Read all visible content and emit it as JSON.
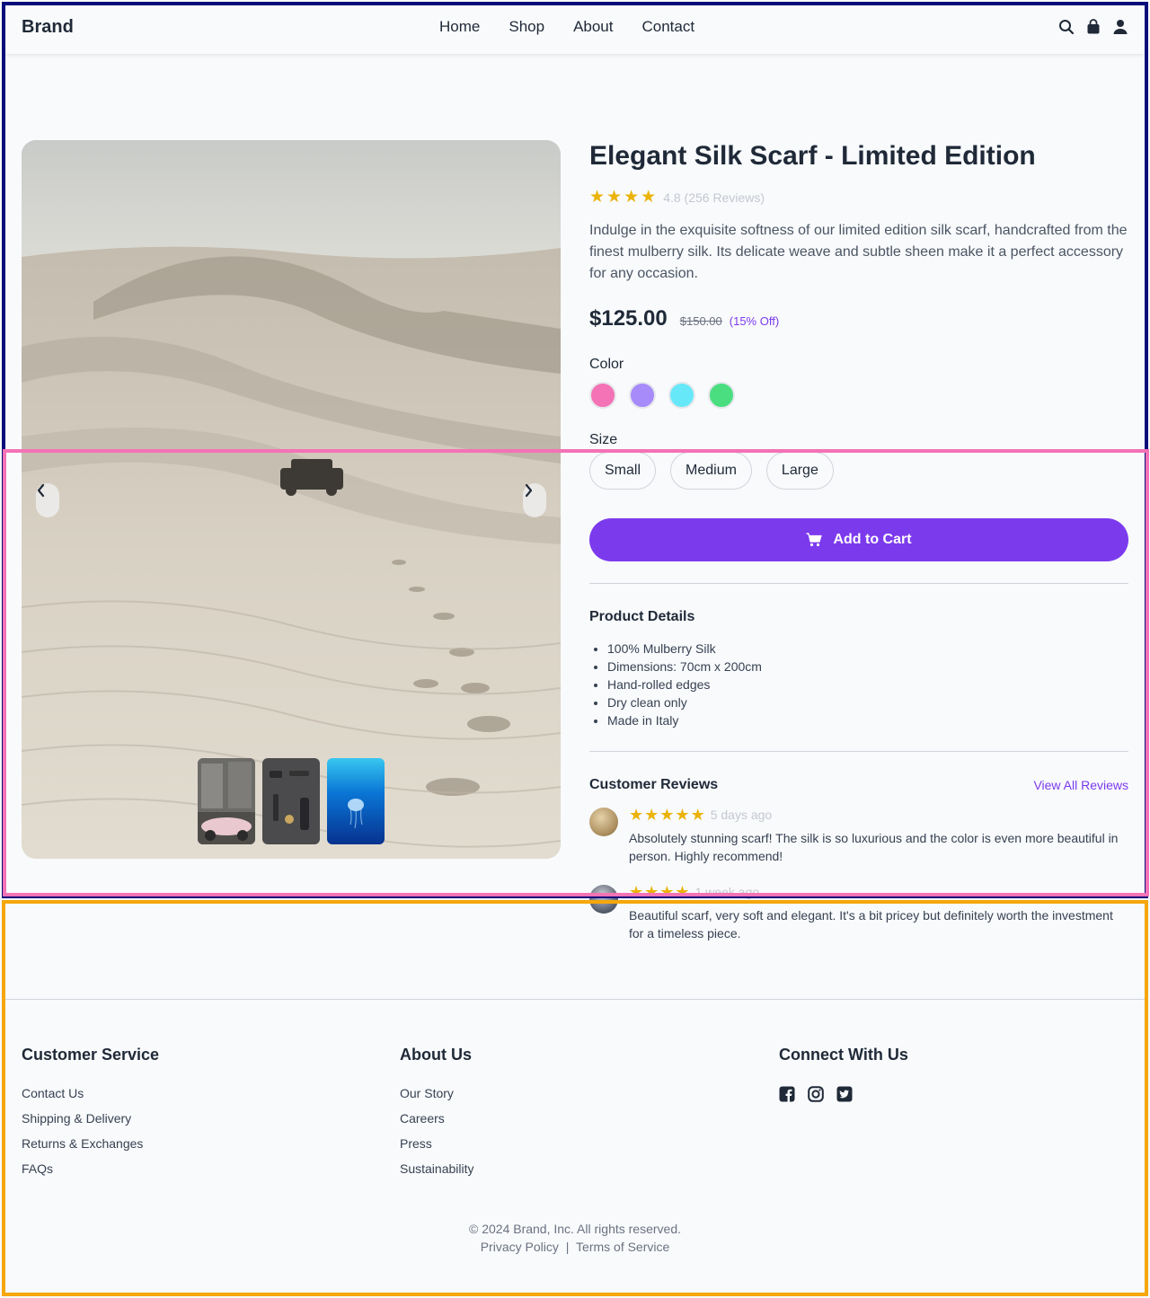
{
  "header": {
    "brand": "Brand",
    "nav": [
      "Home",
      "Shop",
      "About",
      "Contact"
    ],
    "icons": [
      "search-icon",
      "shopping-bag-icon",
      "user-icon"
    ]
  },
  "product": {
    "title": "Elegant Silk Scarf - Limited Edition",
    "rating": 4.8,
    "rating_text": "4.8 (256 Reviews)",
    "description": "Indulge in the exquisite softness of our limited edition silk scarf, handcrafted from the finest mulberry silk. Its delicate weave and subtle sheen make it a perfect accessory for any occasion.",
    "price": "$125.00",
    "old_price": "$150.00",
    "discount": "(15% Off)",
    "color_label": "Color",
    "colors": [
      "#f472b6",
      "#a78bfa",
      "#67e8f9",
      "#4ade80"
    ],
    "size_label": "Size",
    "sizes": [
      "Small",
      "Medium",
      "Large"
    ],
    "add_to_cart": "Add to Cart",
    "details_title": "Product Details",
    "details": [
      "100% Mulberry Silk",
      "Dimensions: 70cm x 200cm",
      "Hand-rolled edges",
      "Dry clean only",
      "Made in Italy"
    ]
  },
  "gallery": {
    "thumbnails": [
      "vintage-car-street",
      "flatlay-accessories",
      "jellyfish-ocean"
    ],
    "active_thumbnail": 0
  },
  "reviews": {
    "title": "Customer Reviews",
    "view_all": "View All Reviews",
    "items": [
      {
        "stars": 5,
        "time": "5 days ago",
        "text": "Absolutely stunning scarf! The silk is so luxurious and the color is even more beautiful in person. Highly recommend!"
      },
      {
        "stars": 4,
        "time": "1 week ago",
        "text": "Beautiful scarf, very soft and elegant. It's a bit pricey but definitely worth the investment for a timeless piece."
      }
    ]
  },
  "footer": {
    "customer_service": {
      "title": "Customer Service",
      "links": [
        "Contact Us",
        "Shipping & Delivery",
        "Returns & Exchanges",
        "FAQs"
      ]
    },
    "about": {
      "title": "About Us",
      "links": [
        "Our Story",
        "Careers",
        "Press",
        "Sustainability"
      ]
    },
    "connect": {
      "title": "Connect With Us",
      "icons": [
        "facebook-icon",
        "instagram-icon",
        "twitter-icon"
      ]
    },
    "copyright": "© 2024 Brand, Inc. All rights reserved.",
    "privacy": "Privacy Policy",
    "separator": "|",
    "terms": "Terms of Service"
  }
}
